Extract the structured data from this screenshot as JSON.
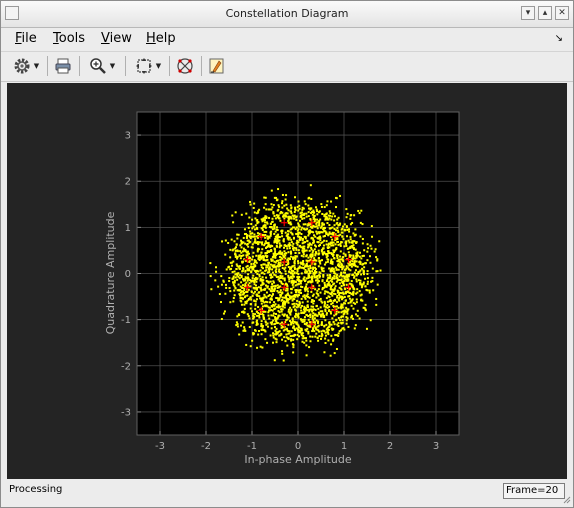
{
  "window": {
    "title": "Constellation Diagram"
  },
  "menubar": {
    "items": [
      {
        "label": "File",
        "underline": "F",
        "rest": "ile"
      },
      {
        "label": "Tools",
        "underline": "T",
        "rest": "ools"
      },
      {
        "label": "View",
        "underline": "V",
        "rest": "iew"
      },
      {
        "label": "Help",
        "underline": "H",
        "rest": "elp"
      }
    ],
    "dock_arrow": "↘"
  },
  "toolbar": {
    "icons": [
      "gear-icon",
      "print-icon",
      "zoom-in-icon",
      "autoscale-icon",
      "measurements-icon",
      "style-icon"
    ]
  },
  "plot": {
    "xlabel": "In-phase Amplitude",
    "ylabel": "Quadrature Amplitude",
    "xticks": [
      "-3",
      "-2",
      "-1",
      "0",
      "1",
      "2",
      "3"
    ],
    "yticks": [
      "3",
      "2",
      "1",
      "0",
      "-1",
      "-2",
      "-3"
    ],
    "colors": {
      "background": "#242424",
      "axes": "#000000",
      "grid": "#4d4d4d",
      "received": "#ffff00",
      "reference": "#ff0000",
      "tick_text": "#b0b0b0"
    }
  },
  "chart_data": {
    "type": "scatter",
    "title": "",
    "xlabel": "In-phase Amplitude",
    "ylabel": "Quadrature Amplitude",
    "xlim": [
      -3.5,
      3.5
    ],
    "ylim": [
      -3.5,
      3.5
    ],
    "grid": true,
    "series": [
      {
        "kind": "received-cloud",
        "color": "#ffff00",
        "center": [
          0,
          0
        ],
        "approx_radius": 1.7
      },
      {
        "kind": "reference-constellation",
        "color": "#ff0000",
        "marker": "+",
        "points": [
          [
            -0.3,
            1.1
          ],
          [
            0.3,
            1.1
          ],
          [
            -0.8,
            0.8
          ],
          [
            0.8,
            0.8
          ],
          [
            -1.1,
            0.3
          ],
          [
            -0.3,
            0.25
          ],
          [
            0.3,
            0.25
          ],
          [
            1.1,
            0.3
          ],
          [
            -1.1,
            -0.3
          ],
          [
            -0.3,
            -0.3
          ],
          [
            0.3,
            -0.3
          ],
          [
            1.1,
            -0.3
          ],
          [
            -0.8,
            -0.8
          ],
          [
            0.8,
            -0.8
          ],
          [
            -0.3,
            -1.1
          ],
          [
            0.3,
            -1.1
          ]
        ]
      }
    ]
  },
  "status": {
    "text": "Processing",
    "frame": "Frame=20"
  }
}
